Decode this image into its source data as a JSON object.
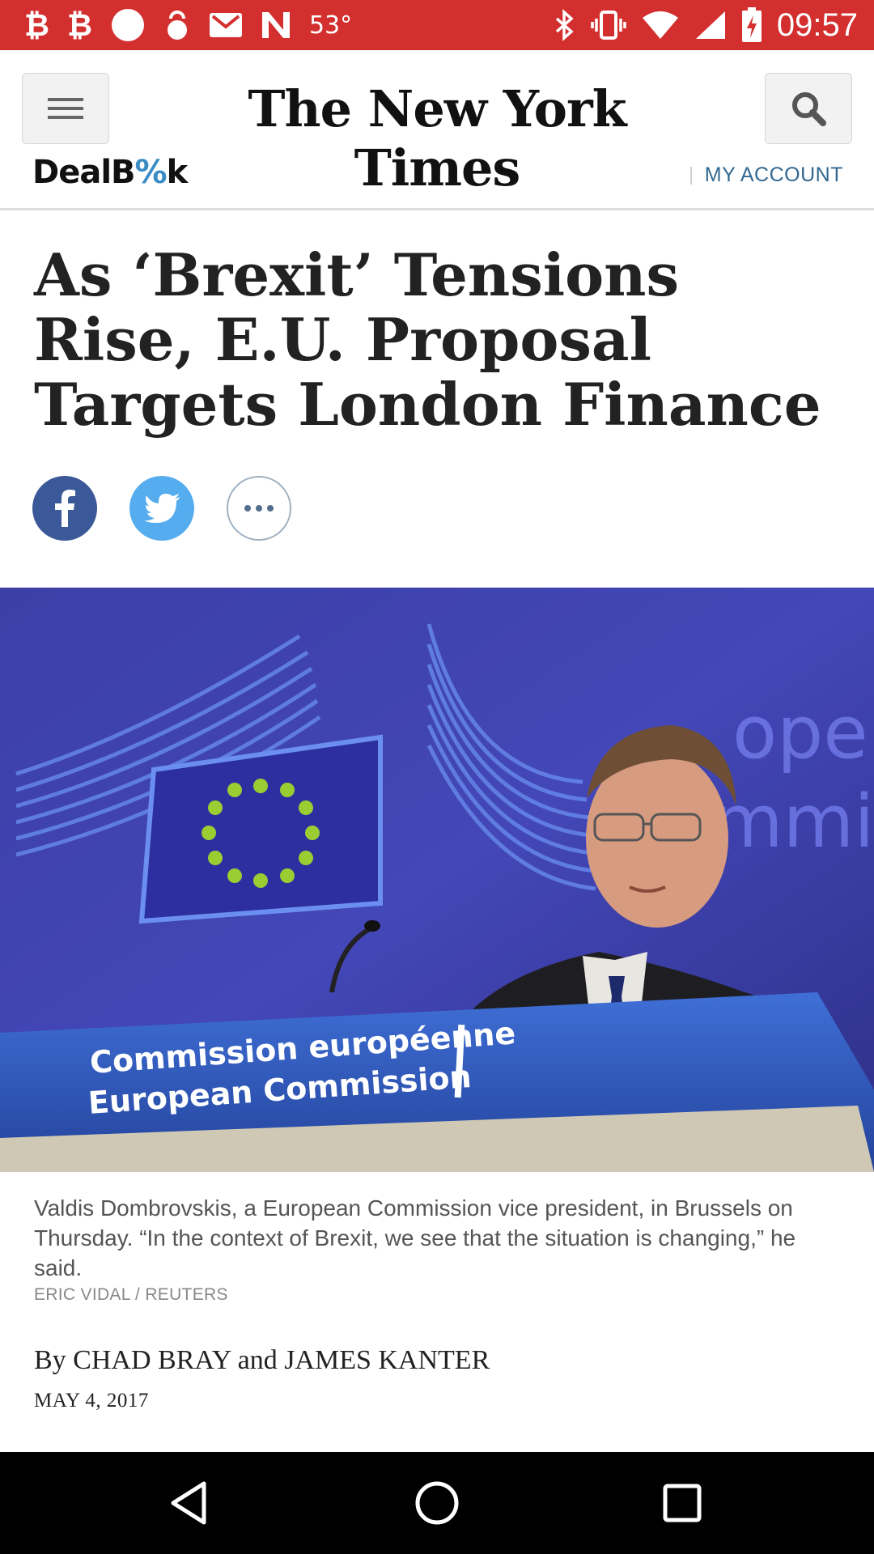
{
  "status_bar": {
    "left_icons": [
      "bitcoin-icon",
      "bitcoin-icon",
      "circle-icon",
      "kettlebell-icon",
      "gmail-icon",
      "n-app-icon"
    ],
    "temperature": "53°",
    "right_icons": [
      "bluetooth-icon",
      "vibrate-icon",
      "wifi-icon",
      "signal-icon",
      "battery-icon"
    ],
    "time": "09:57",
    "bg_color": "#d32f2f"
  },
  "header": {
    "masthead": "The New York Times",
    "section_logo_pre": "DealB",
    "section_logo_accent": "%",
    "section_logo_post": "k",
    "account_link": "MY ACCOUNT",
    "menu_icon": "hamburger-menu-icon",
    "search_icon": "search-icon"
  },
  "article": {
    "headline": "As ‘Brexit’ Tensions Rise, E.U. Proposal Targets London Finance",
    "share": [
      "facebook-icon",
      "twitter-icon",
      "more-options-icon"
    ],
    "photo": {
      "podium_text_line1": "Commission européenne",
      "podium_text_line2": "European Commission",
      "backdrop_text": "ope mmi"
    },
    "caption": "Valdis Dombrovskis, a European Commission vice president, in Brussels on Thursday. “In the context of Brexit, we see that the situation is changing,” he said.",
    "photo_credit": "ERIC VIDAL / REUTERS",
    "byline": "By CHAD BRAY and JAMES KANTER",
    "date": "MAY 4, 2017"
  },
  "nav_bar": {
    "buttons": [
      "back-icon",
      "home-icon",
      "recents-icon"
    ]
  },
  "colors": {
    "facebook": "#3b5998",
    "twitter": "#55acee",
    "link": "#326891"
  }
}
